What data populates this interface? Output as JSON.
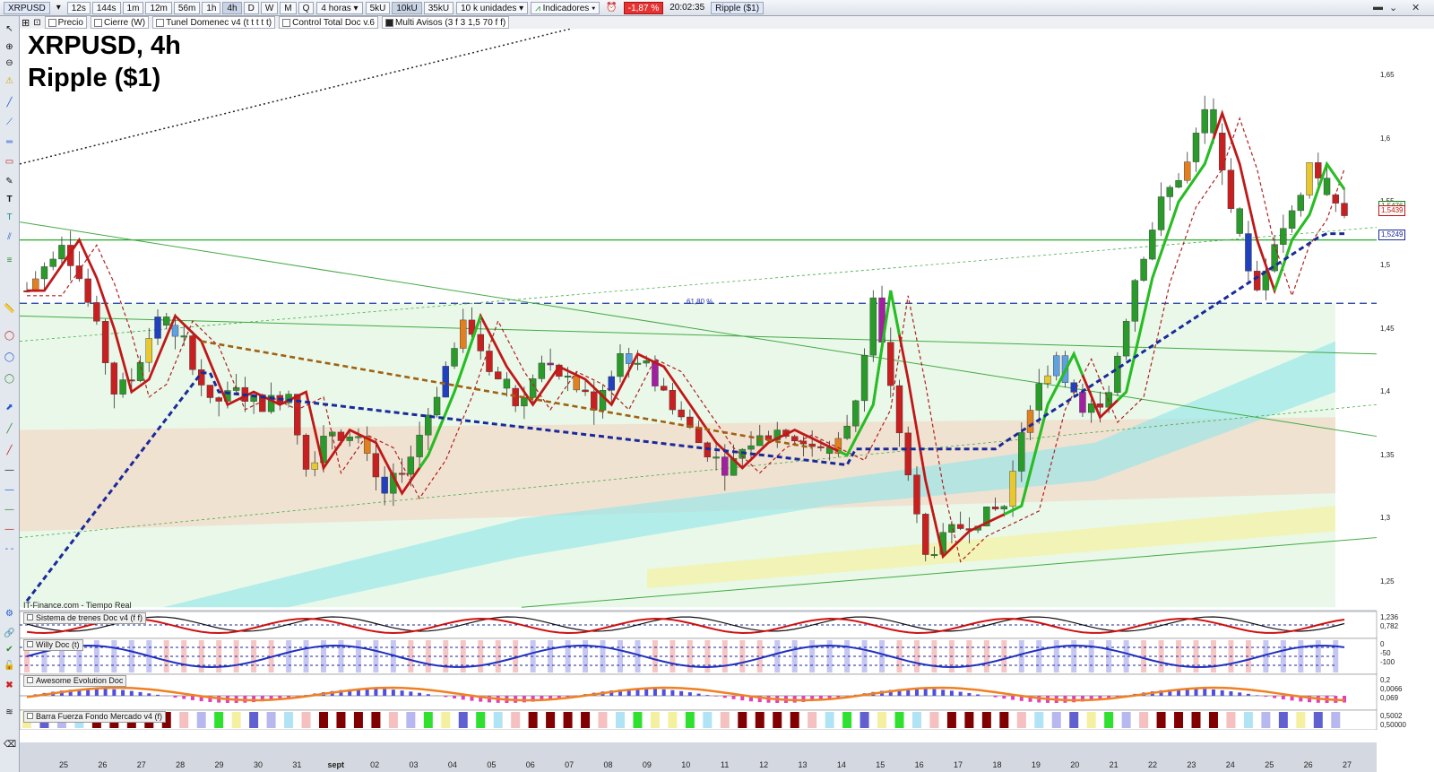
{
  "toolbar": {
    "symbol": "XRPUSD",
    "buttons": [
      "12s",
      "144s",
      "1m",
      "12m",
      "56m",
      "1h",
      "4h",
      "D",
      "W",
      "M",
      "Q"
    ],
    "active_button": "4h",
    "timeframe": "4 horas",
    "units": [
      "5kU",
      "10kU",
      "35kU"
    ],
    "active_unit": "10kU",
    "units_dropdown": "10 k unidades",
    "indicators_label": "Indicadores",
    "change": "-1,87 %",
    "time": "20:02:35",
    "name_badge": "Ripple ($1)"
  },
  "indicators_bar": [
    {
      "label": "Precio",
      "style": "white"
    },
    {
      "label": "Cierre (W)",
      "style": "white"
    },
    {
      "label": "Tunel Domenec v4 (t t t t t)",
      "style": "white"
    },
    {
      "label": "Control Total Doc v.6",
      "style": "white"
    },
    {
      "label": "Multi Avisos (3 f 3 1,5 70 f f)",
      "style": "dark"
    }
  ],
  "chart_title": {
    "line1": "XRPUSD, 4h",
    "line2": "Ripple ($1)"
  },
  "source_label": "IT-Finance.com - Tiempo Real",
  "fib_label": "61,80 %",
  "price_axis": [
    {
      "label": "1,65",
      "v": 1.65
    },
    {
      "label": "1,6",
      "v": 1.6
    },
    {
      "label": "1,55",
      "v": 1.55
    },
    {
      "label": "1,5",
      "v": 1.5
    },
    {
      "label": "1,45",
      "v": 1.45
    },
    {
      "label": "1,4",
      "v": 1.4
    },
    {
      "label": "1,35",
      "v": 1.35
    },
    {
      "label": "1,3",
      "v": 1.3
    },
    {
      "label": "1,25",
      "v": 1.25
    }
  ],
  "price_badges": [
    {
      "label": "1,5476",
      "v": 1.5476,
      "color": "#1a7a1a"
    },
    {
      "label": "1,5439",
      "v": 1.5439,
      "color": "#c01010"
    },
    {
      "label": "1,5249",
      "v": 1.5249,
      "color": "#1a2a9a"
    }
  ],
  "x_axis": [
    "25",
    "26",
    "27",
    "28",
    "29",
    "30",
    "31",
    "sept",
    "02",
    "03",
    "04",
    "05",
    "06",
    "07",
    "08",
    "09",
    "10",
    "11",
    "12",
    "13",
    "14",
    "15",
    "16",
    "17",
    "18",
    "19",
    "20",
    "21",
    "22",
    "23",
    "24",
    "25",
    "26",
    "27"
  ],
  "subpanels": [
    {
      "title": "Sistema de trenes Doc v4 (f f)",
      "scale": [
        "1,236",
        "0,782"
      ]
    },
    {
      "title": "Willy Doc (t)",
      "scale": [
        "0",
        "-50",
        "-100"
      ]
    },
    {
      "title": "Awesome Evolution Doc",
      "scale": [
        "0,2",
        "0,0066",
        "0,069"
      ]
    },
    {
      "title": "Barra Fuerza Fondo Mercado v4 (f)",
      "scale": [
        "0,5002",
        "0,50000"
      ]
    }
  ],
  "chart_data": {
    "type": "candlestick",
    "title": "XRPUSD, 4h",
    "subtitle": "Ripple ($1)",
    "ylim": [
      1.23,
      1.69
    ],
    "x_labels": [
      "25",
      "26",
      "27",
      "28",
      "29",
      "30",
      "31",
      "sept",
      "02",
      "03",
      "04",
      "05",
      "06",
      "07",
      "08",
      "09",
      "10",
      "11",
      "12",
      "13",
      "14",
      "15",
      "16",
      "17",
      "18",
      "19",
      "20",
      "21",
      "22",
      "23",
      "24",
      "25",
      "26",
      "27"
    ],
    "close_path": [
      {
        "t": 0,
        "c": 1.48
      },
      {
        "t": 2,
        "c": 1.5
      },
      {
        "t": 4,
        "c": 1.52
      },
      {
        "t": 6,
        "c": 1.49
      },
      {
        "t": 8,
        "c": 1.45
      },
      {
        "t": 10,
        "c": 1.4
      },
      {
        "t": 12,
        "c": 1.41
      },
      {
        "t": 15,
        "c": 1.46
      },
      {
        "t": 18,
        "c": 1.44
      },
      {
        "t": 21,
        "c": 1.39
      },
      {
        "t": 24,
        "c": 1.4
      },
      {
        "t": 27,
        "c": 1.39
      },
      {
        "t": 30,
        "c": 1.4
      },
      {
        "t": 32,
        "c": 1.34
      },
      {
        "t": 35,
        "c": 1.37
      },
      {
        "t": 38,
        "c": 1.36
      },
      {
        "t": 41,
        "c": 1.32
      },
      {
        "t": 44,
        "c": 1.35
      },
      {
        "t": 47,
        "c": 1.4
      },
      {
        "t": 50,
        "c": 1.46
      },
      {
        "t": 53,
        "c": 1.42
      },
      {
        "t": 56,
        "c": 1.39
      },
      {
        "t": 59,
        "c": 1.42
      },
      {
        "t": 62,
        "c": 1.41
      },
      {
        "t": 65,
        "c": 1.39
      },
      {
        "t": 68,
        "c": 1.43
      },
      {
        "t": 71,
        "c": 1.42
      },
      {
        "t": 74,
        "c": 1.39
      },
      {
        "t": 77,
        "c": 1.36
      },
      {
        "t": 80,
        "c": 1.34
      },
      {
        "t": 83,
        "c": 1.36
      },
      {
        "t": 86,
        "c": 1.37
      },
      {
        "t": 89,
        "c": 1.36
      },
      {
        "t": 92,
        "c": 1.35
      },
      {
        "t": 95,
        "c": 1.39
      },
      {
        "t": 97,
        "c": 1.48
      },
      {
        "t": 99,
        "c": 1.41
      },
      {
        "t": 101,
        "c": 1.33
      },
      {
        "t": 103,
        "c": 1.27
      },
      {
        "t": 106,
        "c": 1.29
      },
      {
        "t": 109,
        "c": 1.3
      },
      {
        "t": 112,
        "c": 1.31
      },
      {
        "t": 115,
        "c": 1.39
      },
      {
        "t": 118,
        "c": 1.43
      },
      {
        "t": 121,
        "c": 1.38
      },
      {
        "t": 124,
        "c": 1.4
      },
      {
        "t": 127,
        "c": 1.49
      },
      {
        "t": 130,
        "c": 1.55
      },
      {
        "t": 133,
        "c": 1.58
      },
      {
        "t": 135,
        "c": 1.62
      },
      {
        "t": 137,
        "c": 1.58
      },
      {
        "t": 139,
        "c": 1.52
      },
      {
        "t": 141,
        "c": 1.48
      },
      {
        "t": 143,
        "c": 1.52
      },
      {
        "t": 145,
        "c": 1.54
      },
      {
        "t": 147,
        "c": 1.58
      },
      {
        "t": 149,
        "c": 1.56
      },
      {
        "t": 151,
        "c": 1.54
      }
    ],
    "horizontal_levels": [
      {
        "v": 1.52,
        "style": "solid",
        "color": "#22aa22"
      },
      {
        "v": 1.47,
        "style": "dashed",
        "color": "#1a3aa0",
        "label": "61,80 %"
      }
    ]
  }
}
